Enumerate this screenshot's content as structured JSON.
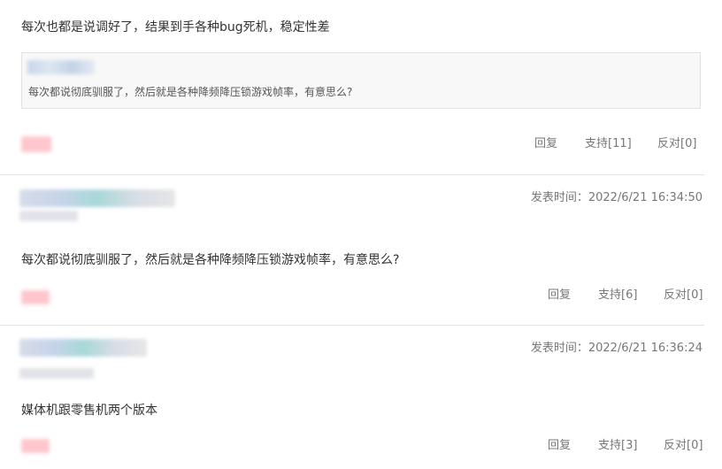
{
  "comments": [
    {
      "body": "每次也都是说调好了，结果到手各种bug死机，稳定性差",
      "quote": "每次都说彻底驯服了，然后就是各种降频降压锁游戏帧率，有意思么?",
      "actions": {
        "reply": "回复",
        "support": "支持[11]",
        "oppose": "反对[0]"
      }
    },
    {
      "post_time": "发表时间：2022/6/21 16:34:50",
      "body": "每次都说彻底驯服了，然后就是各种降频降压锁游戏帧率，有意思么?",
      "actions": {
        "reply": "回复",
        "support": "支持[6]",
        "oppose": "反对[0]"
      }
    },
    {
      "post_time": "发表时间：2022/6/21 16:36:24",
      "body": "媒体机跟零售机两个版本",
      "actions": {
        "reply": "回复",
        "support": "支持[3]",
        "oppose": "反对[0]"
      }
    }
  ]
}
